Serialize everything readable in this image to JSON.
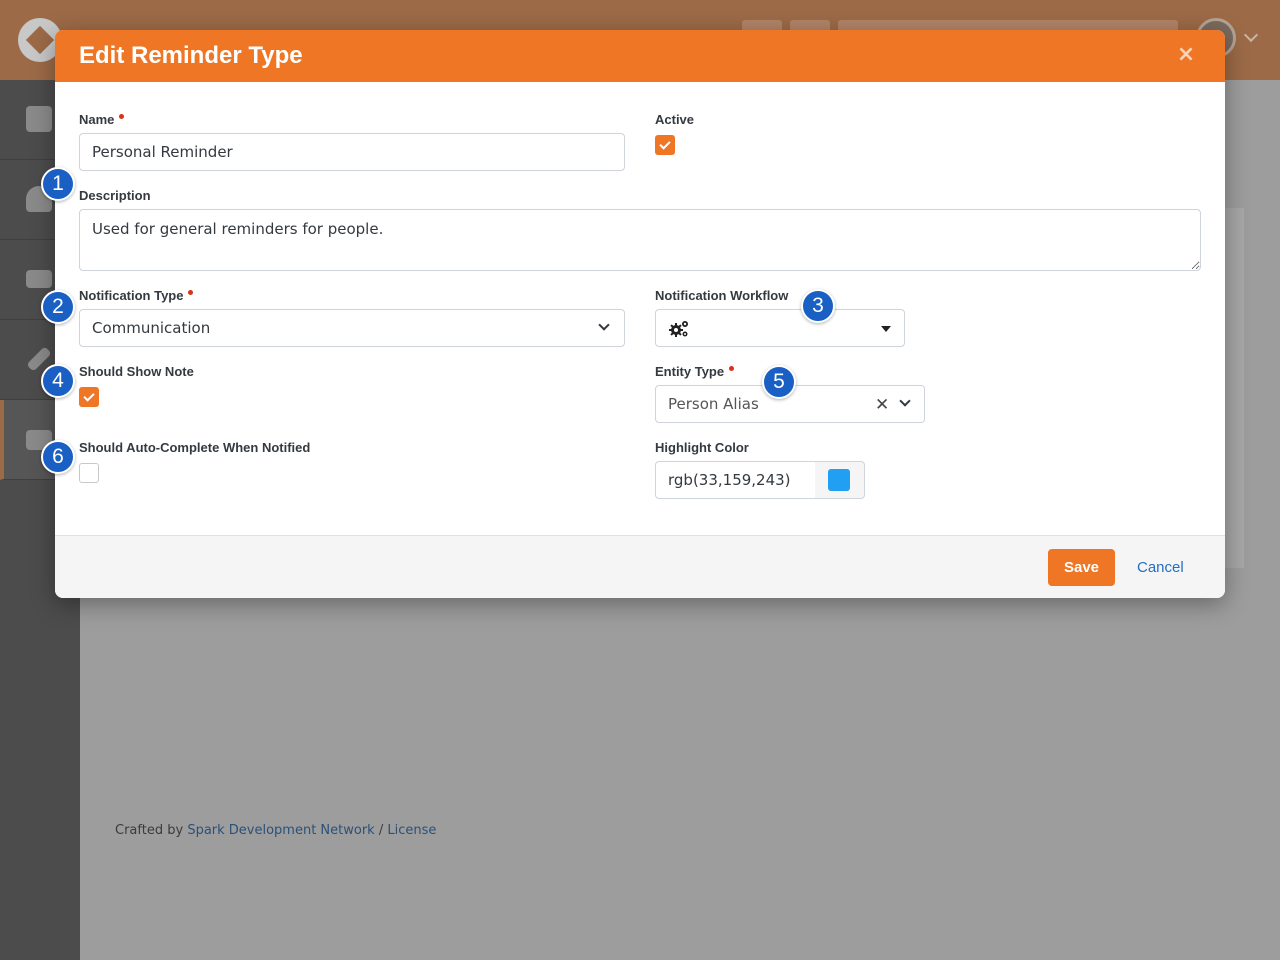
{
  "background": {
    "footer": {
      "prefix": "Crafted by",
      "link1": "Spark Development Network",
      "separator": "/",
      "link2": "License"
    }
  },
  "modal": {
    "title": "Edit Reminder Type",
    "close_icon": "close-icon",
    "fields": {
      "name": {
        "label": "Name",
        "required": true,
        "value": "Personal Reminder"
      },
      "active": {
        "label": "Active",
        "checked": true
      },
      "description": {
        "label": "Description",
        "value": "Used for general reminders for people."
      },
      "notification_type": {
        "label": "Notification Type",
        "required": true,
        "value": "Communication"
      },
      "notification_workflow": {
        "label": "Notification Workflow",
        "value": "",
        "icon": "gears-icon"
      },
      "should_show_note": {
        "label": "Should Show Note",
        "checked": true
      },
      "entity_type": {
        "label": "Entity Type",
        "required": true,
        "value": "Person Alias"
      },
      "should_auto_complete": {
        "label": "Should Auto-Complete When Notified",
        "checked": false
      },
      "highlight_color": {
        "label": "Highlight Color",
        "value": "rgb(33,159,243)",
        "swatch": "#219ff3"
      }
    },
    "footer": {
      "save_label": "Save",
      "cancel_label": "Cancel"
    }
  },
  "callouts": [
    "1",
    "2",
    "3",
    "4",
    "5",
    "6"
  ],
  "colors": {
    "accent": "#ee7624",
    "callout": "#1a5fc4",
    "link": "#2370c0"
  }
}
